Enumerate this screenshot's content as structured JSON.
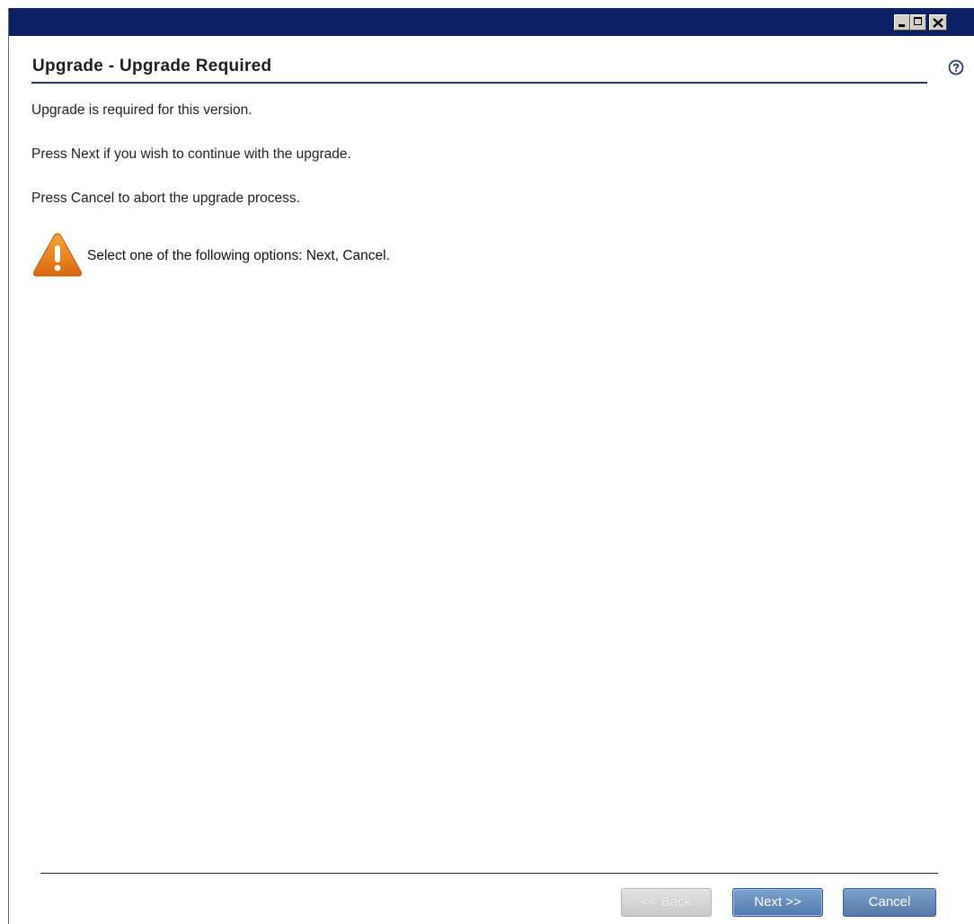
{
  "window": {
    "controls": [
      "minimize-icon",
      "maximize-icon",
      "close-icon"
    ],
    "titlebar_color": "#0b2164"
  },
  "header": {
    "title": "Upgrade - Upgrade Required",
    "help_icon": "help-icon"
  },
  "content": {
    "line1": "Upgrade is required for this version.",
    "line2": "Press Next if you wish to continue with the upgrade.",
    "line3": "Press Cancel to abort the upgrade process.",
    "warning": {
      "icon": "warning-icon",
      "text": "Select one of the following options: Next, Cancel."
    }
  },
  "footer": {
    "back_label": "<< Back",
    "next_label": "Next >>",
    "cancel_label": "Cancel",
    "back_enabled": false
  },
  "colors": {
    "accent": "#1e3c6f",
    "warning": "#e8801e",
    "button_blue": "#5a80b3"
  }
}
